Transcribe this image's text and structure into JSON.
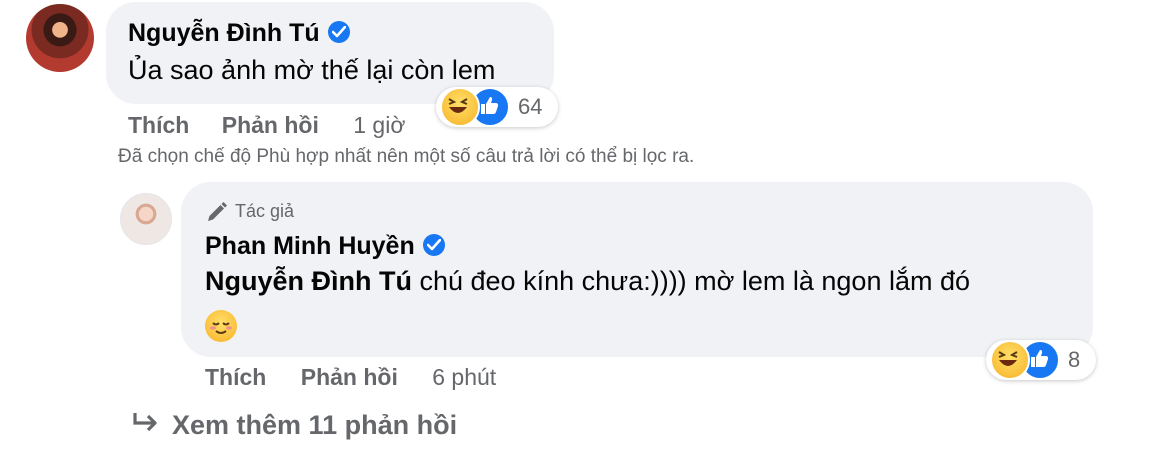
{
  "comment": {
    "author": "Nguyễn Đình Tú",
    "text": "Ủa sao ảnh mờ thế lại còn lem",
    "like_label": "Thích",
    "reply_label": "Phản hồi",
    "time": "1 giờ",
    "reaction_count": "64"
  },
  "filter_note": "Đã chọn chế độ Phù hợp nhất nên một số câu trả lời có thể bị lọc ra.",
  "reply": {
    "author_tag": "Tác giả",
    "author": "Phan Minh Huyền",
    "mention": "Nguyễn Đình Tú",
    "text": " chú đeo kính chưa:)))) mờ lem là ngon lắm đó",
    "like_label": "Thích",
    "reply_label": "Phản hồi",
    "time": "6 phút",
    "reaction_count": "8"
  },
  "see_more": "Xem thêm 11 phản hồi",
  "colors": {
    "bubble": "#f0f2f5",
    "verified": "#1877f2",
    "secondary_text": "#65676b"
  }
}
